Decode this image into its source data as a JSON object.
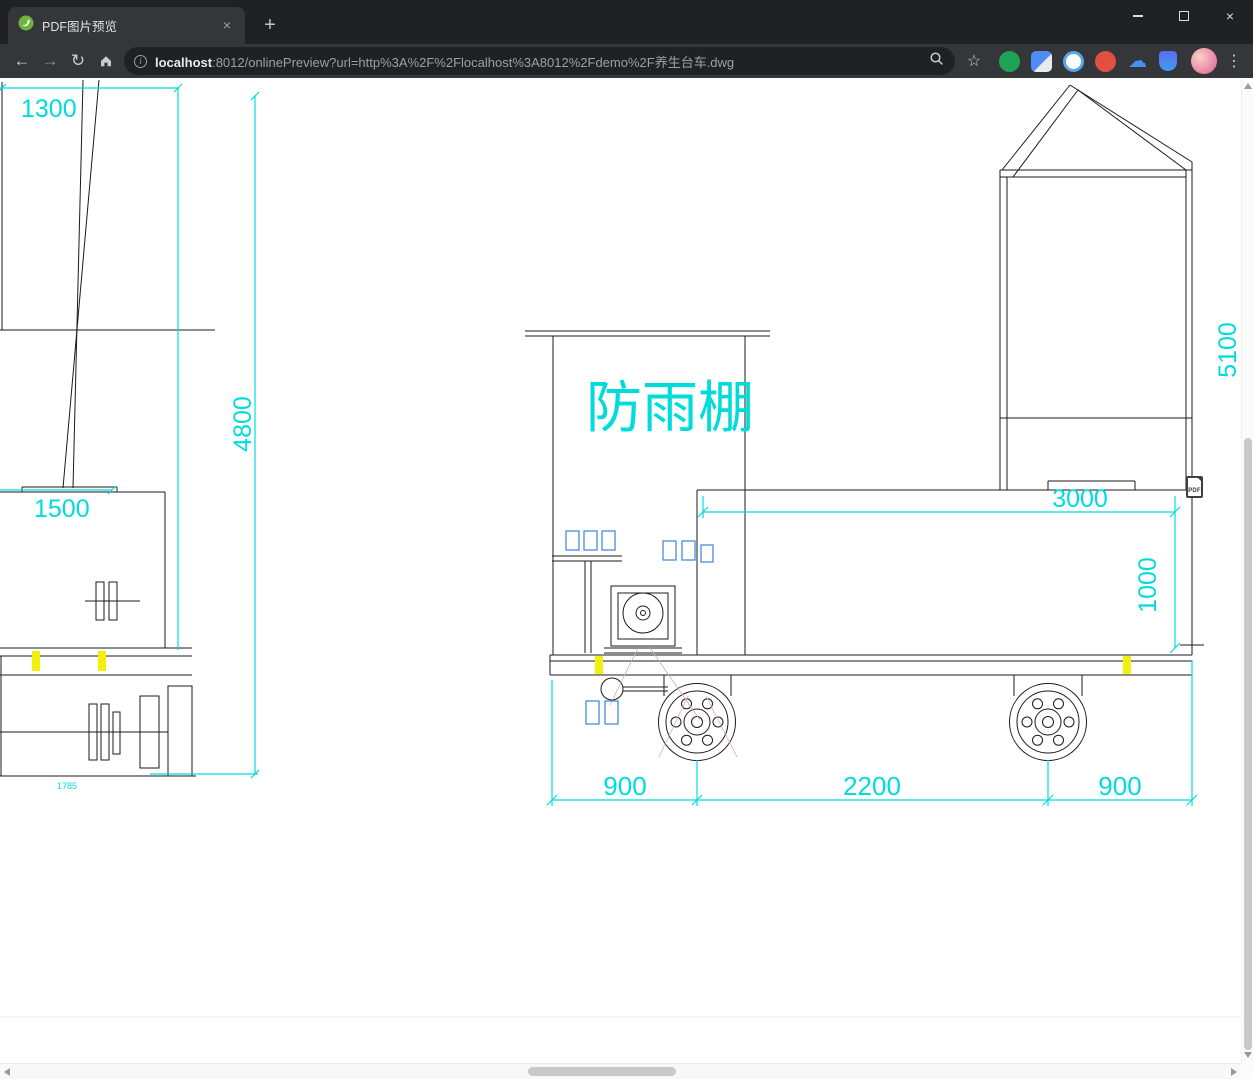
{
  "colors": {
    "cad_cyan": "#00dcdc",
    "cad_yellow": "#f2ef0c",
    "cad_blue": "#3b82d8",
    "cad_pink": "#dca8b8",
    "cad_line": "#1b1b1b",
    "chrome_dark": "#202124",
    "chrome_toolbar": "#35363a",
    "url_dim": "#9aa0a6",
    "url_bright": "#e8eaed"
  },
  "window_controls": {
    "close_glyph": "×"
  },
  "tabbar": {
    "tab_title": "PDF图片预览",
    "close_glyph": "×",
    "new_tab_glyph": "+"
  },
  "toolbar": {
    "back_glyph": "←",
    "forward_glyph": "→",
    "reload_glyph": "↻",
    "info_glyph": "i",
    "star_glyph": "☆",
    "menu_glyph": "⋮",
    "cloud_glyph": "☁",
    "url_host": "localhost",
    "url_rest": ":8012/onlinePreview?url=http%3A%2F%2Flocalhost%3A8012%2Fdemo%2F养生台车.dwg"
  },
  "viewer": {
    "pdf_badge": "PDF"
  },
  "drawing": {
    "shelter_label": "防雨棚",
    "dims": {
      "h1300": "1300",
      "v4800": "4800",
      "h1500": "1500",
      "small1785": "1785",
      "v5100": "5100",
      "h3000": "3000",
      "v1000": "1000",
      "b900l": "900",
      "b2200": "2200",
      "b900r": "900"
    }
  }
}
